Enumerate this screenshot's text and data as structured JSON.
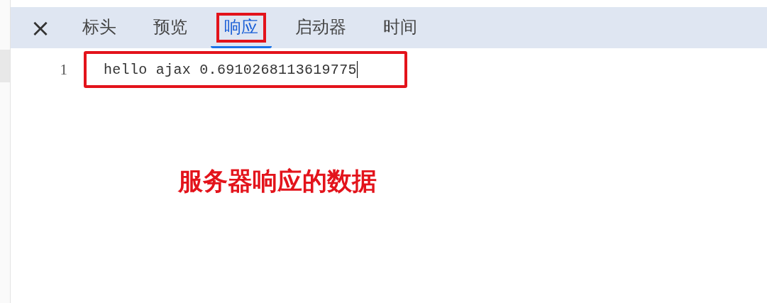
{
  "close_button": {
    "label": "×"
  },
  "tabs": [
    {
      "label": "标头",
      "selected": false,
      "annotated": false
    },
    {
      "label": "预览",
      "selected": false,
      "annotated": false
    },
    {
      "label": "响应",
      "selected": true,
      "annotated": true
    },
    {
      "label": "启动器",
      "selected": false,
      "annotated": false
    },
    {
      "label": "时间",
      "selected": false,
      "annotated": false
    }
  ],
  "response_lines": [
    {
      "number": "1",
      "text": "hello ajax 0.6910268113619775",
      "annotated": true,
      "cursor": true
    }
  ],
  "annotation": {
    "text": "服务器响应的数据"
  }
}
